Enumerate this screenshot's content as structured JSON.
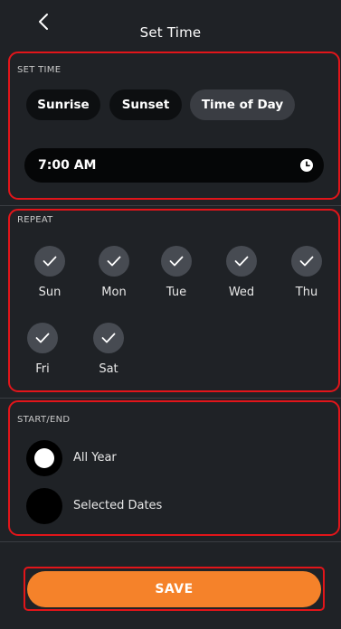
{
  "header": {
    "title": "Set Time",
    "back_icon": "chevron-left-icon"
  },
  "set_time": {
    "label": "SET TIME",
    "options": [
      {
        "label": "Sunrise",
        "selected": false
      },
      {
        "label": "Sunset",
        "selected": false
      },
      {
        "label": "Time of Day",
        "selected": true
      }
    ],
    "time_value": "7:00 AM",
    "time_icon": "clock-icon"
  },
  "repeat": {
    "label": "REPEAT",
    "days": [
      {
        "label": "Sun",
        "checked": true
      },
      {
        "label": "Mon",
        "checked": true
      },
      {
        "label": "Tue",
        "checked": true
      },
      {
        "label": "Wed",
        "checked": true
      },
      {
        "label": "Thu",
        "checked": true
      },
      {
        "label": "Fri",
        "checked": true
      },
      {
        "label": "Sat",
        "checked": true
      }
    ]
  },
  "start_end": {
    "label": "START/END",
    "options": [
      {
        "label": "All Year",
        "selected": true
      },
      {
        "label": "Selected Dates",
        "selected": false
      }
    ]
  },
  "save": {
    "label": "SAVE"
  },
  "colors": {
    "background": "#1f2226",
    "highlight_border": "#e2151a",
    "accent": "#f5822a"
  }
}
